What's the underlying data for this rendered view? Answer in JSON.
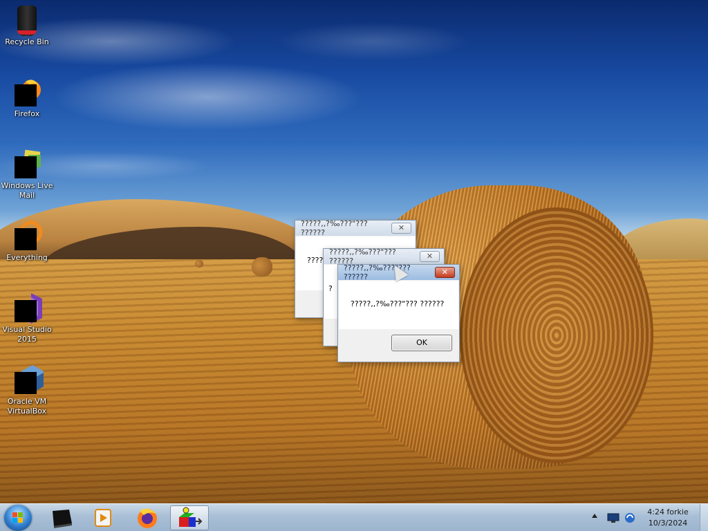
{
  "desktop": {
    "icons": [
      {
        "label": "Recycle Bin",
        "icon": "recycle-bin-icon"
      },
      {
        "label": "Firefox",
        "icon": "firefox-icon"
      },
      {
        "label": "Windows Live Mail",
        "icon": "windows-live-mail-icon"
      },
      {
        "label": "Everything",
        "icon": "everything-icon"
      },
      {
        "label": "Visual Studio 2015",
        "icon": "visual-studio-icon"
      },
      {
        "label": "Oracle VM VirtualBox",
        "icon": "virtualbox-icon"
      }
    ]
  },
  "dialogs": [
    {
      "title": "?????,,?‰???\"??? ??????",
      "message": "?????",
      "close": "✕"
    },
    {
      "title": "?????,,?‰???\"??? ??????",
      "message": "?",
      "close": "✕"
    },
    {
      "title": "?????,,?‰???\"??? ??????",
      "message": "?????,,?‰???\"??? ??????",
      "ok": "OK",
      "close": "✕"
    }
  ],
  "taskbar": {
    "buttons": [
      {
        "icon": "start-orb-icon"
      },
      {
        "icon": "black-app-icon"
      },
      {
        "icon": "media-player-icon"
      },
      {
        "icon": "firefox-icon"
      },
      {
        "icon": "cube-app-icon",
        "active": true
      }
    ],
    "tray": {
      "icons": [
        "show-hidden-icons-icon",
        "network-icon",
        "sync-icon"
      ],
      "time": "4:24 forkie",
      "date": "10/3/2024"
    }
  },
  "colors": {
    "taskbar": "#a9bfd6",
    "dialog_close_active": "#c43a1f",
    "sky": "#1749a0",
    "field": "#c4862f"
  }
}
